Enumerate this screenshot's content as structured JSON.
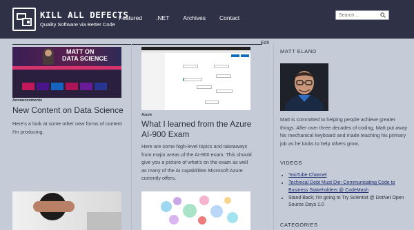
{
  "site": {
    "title": "KILL ALL DEFECTS",
    "tagline": "Quality Software via Better Code",
    "logo_icon": "kad-logo-icon"
  },
  "nav": {
    "items": [
      "Featured",
      ".NET",
      "Archives",
      "Contact"
    ]
  },
  "search": {
    "placeholder": "Search ..."
  },
  "edit_label": "Edit",
  "posts": [
    {
      "thumb": {
        "line1": "MATT ON",
        "line2": "DATA SCIENCE"
      },
      "tag": "Announcements",
      "title": "New Content on Data Science",
      "excerpt": "Here's a look at some other new forms of content I'm producing."
    },
    {
      "tag": "Azure",
      "title": "What I learned from the Azure AI-900 Exam",
      "excerpt": "Here are some high-level topics and takeaways from major areas of the AI-900 exam. This should give you a picture of what's on the exam as well as many of the AI capabilities Microsoft Azure currently offers."
    }
  ],
  "sidebar": {
    "about_heading": "MATT ELAND",
    "bio": "Matt is committed to helping people achieve greater things. After over three decades of coding, Matt put away his mechanical keyboard and made teaching his primary job as he looks to help others grow.",
    "videos_heading": "VIDEOS",
    "videos": [
      "YouTube Channel",
      "Technical Debt Must Die: Communicating Code to Business Stakeholders @ CodeMash",
      "Stand Back; I'm going to Try Scientist @ DotNet Open Source Days 1.0"
    ],
    "categories_heading": "CATEGORIES"
  },
  "colors": {
    "header_bg": "#2f3247",
    "page_bg": "#c5ccd8",
    "link": "#1c2a6e"
  }
}
